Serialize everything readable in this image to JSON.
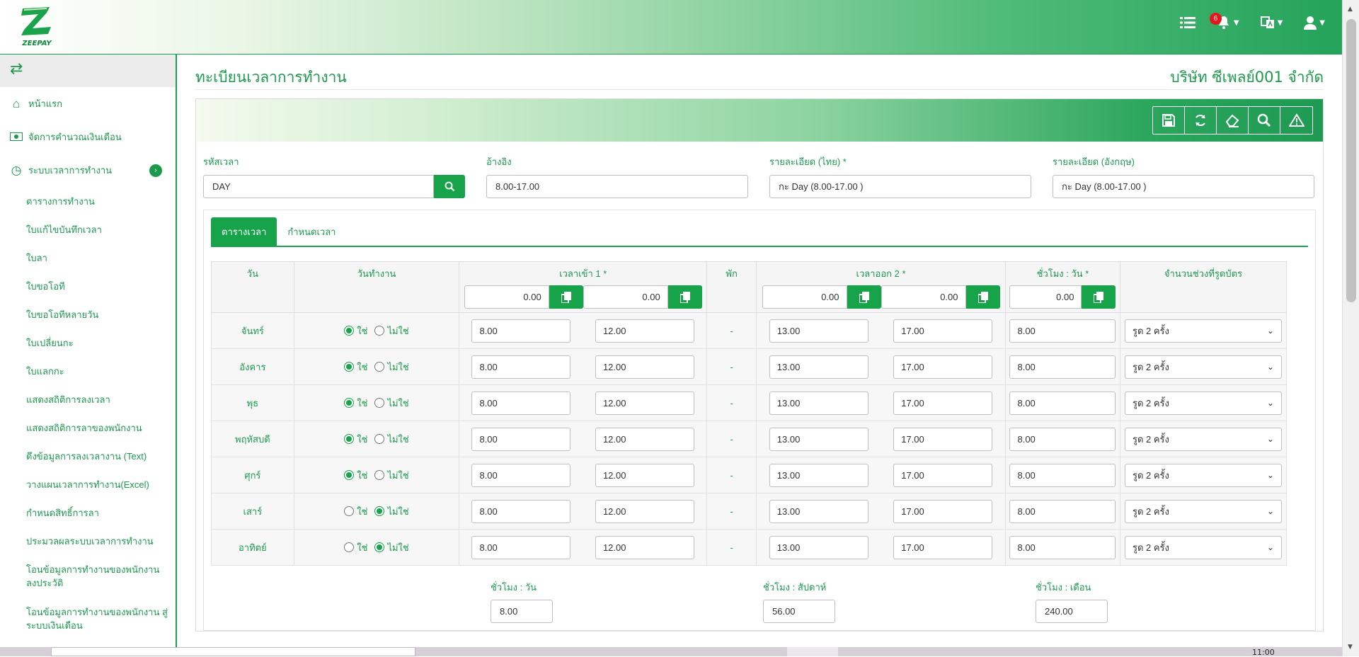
{
  "app": {
    "logo_text": "ZEEPAY"
  },
  "topbar": {
    "notification_count": "6"
  },
  "sidebar": {
    "items": [
      {
        "label": "หน้าแรก",
        "icon": "home-icon"
      },
      {
        "label": "จัดการคำนวณเงินเดือน",
        "icon": "money-icon"
      },
      {
        "label": "ระบบเวลาการทำงาน",
        "icon": "clock-icon"
      }
    ],
    "sub_items": [
      "ตารางการทำงาน",
      "ใบแก้ไขบันทึกเวลา",
      "ใบลา",
      "ใบขอโอที",
      "ใบขอโอทีหลายวัน",
      "ใบเปลี่ยนกะ",
      "ใบแลกกะ",
      "แสดงสถิติการลงเวลา",
      "แสดงสถิติการลาของพนักงาน",
      "ดึงข้อมูลการลงเวลางาน (Text)",
      "วางแผนเวลาการทำงาน(Excel)",
      "กำหนดสิทธิ์การลา",
      "ประมวลผลระบบเวลาการทำงาน",
      "โอนข้อมูลการทำงานของพนักงาน ลงประวัติ",
      "โอนข้อมูลการทำงานของพนักงาน สู่ระบบเงินเดือน"
    ]
  },
  "page": {
    "title": "ทะเบียนเวลาการทำงาน",
    "company": "บริษัท ซีเพลย์001 จำกัด"
  },
  "form": {
    "code_label": "รหัสเวลา",
    "code_value": "DAY",
    "ref_label": "อ้างอิง",
    "ref_value": "8.00-17.00",
    "desc_th_label": "รายละเอียด (ไทย) *",
    "desc_th_value": "กะ Day (8.00-17.00 )",
    "desc_en_label": "รายละเอียด (อังกฤษ)",
    "desc_en_value": "กะ Day (8.00-17.00 )"
  },
  "tabs": [
    "ตารางเวลา",
    "กำหนดเวลา"
  ],
  "table": {
    "headers": {
      "day": "วัน",
      "workday": "วันทำงาน",
      "time_in": "เวลาเข้า 1 *",
      "break": "พัก",
      "time_out": "เวลาออก 2 *",
      "hours_per_day": "ชั่วโมง : วัน *",
      "swipe_count": "จำนวนช่วงที่รูดบัตร"
    },
    "header_inputs": {
      "in_a": "0.00",
      "in_b": "0.00",
      "out_a": "0.00",
      "out_b": "0.00",
      "hours": "0.00"
    },
    "yes_label": "ใช่",
    "no_label": "ไม่ใช่",
    "rows": [
      {
        "day": "จันทร์",
        "yes": true,
        "in1": "8.00",
        "in2": "12.00",
        "brk": "-",
        "out1": "13.00",
        "out2": "17.00",
        "hours": "8.00",
        "swipe": "รูด 2 ครั้ง"
      },
      {
        "day": "อังคาร",
        "yes": true,
        "in1": "8.00",
        "in2": "12.00",
        "brk": "-",
        "out1": "13.00",
        "out2": "17.00",
        "hours": "8.00",
        "swipe": "รูด 2 ครั้ง"
      },
      {
        "day": "พุธ",
        "yes": true,
        "in1": "8.00",
        "in2": "12.00",
        "brk": "-",
        "out1": "13.00",
        "out2": "17.00",
        "hours": "8.00",
        "swipe": "รูด 2 ครั้ง"
      },
      {
        "day": "พฤหัสบดี",
        "yes": true,
        "in1": "8.00",
        "in2": "12.00",
        "brk": "-",
        "out1": "13.00",
        "out2": "17.00",
        "hours": "8.00",
        "swipe": "รูด 2 ครั้ง"
      },
      {
        "day": "ศุกร์",
        "yes": true,
        "in1": "8.00",
        "in2": "12.00",
        "brk": "-",
        "out1": "13.00",
        "out2": "17.00",
        "hours": "8.00",
        "swipe": "รูด 2 ครั้ง"
      },
      {
        "day": "เสาร์",
        "yes": false,
        "in1": "8.00",
        "in2": "12.00",
        "brk": "-",
        "out1": "13.00",
        "out2": "17.00",
        "hours": "8.00",
        "swipe": "รูด 2 ครั้ง"
      },
      {
        "day": "อาทิตย์",
        "yes": false,
        "in1": "8.00",
        "in2": "12.00",
        "brk": "-",
        "out1": "13.00",
        "out2": "17.00",
        "hours": "8.00",
        "swipe": "รูด 2 ครั้ง"
      }
    ]
  },
  "totals": {
    "per_day_label": "ชั่วโมง : วัน",
    "per_day_value": "8.00",
    "per_week_label": "ชั่วโมง : สัปดาห์",
    "per_week_value": "56.00",
    "per_month_label": "ชั่วโมง : เดือน",
    "per_month_value": "240.00"
  },
  "taskbar": {
    "time_partial": "11:00"
  },
  "colors": {
    "brand": "#16a34a",
    "text_green": "#1b9a4c",
    "badge": "#e8141c"
  }
}
